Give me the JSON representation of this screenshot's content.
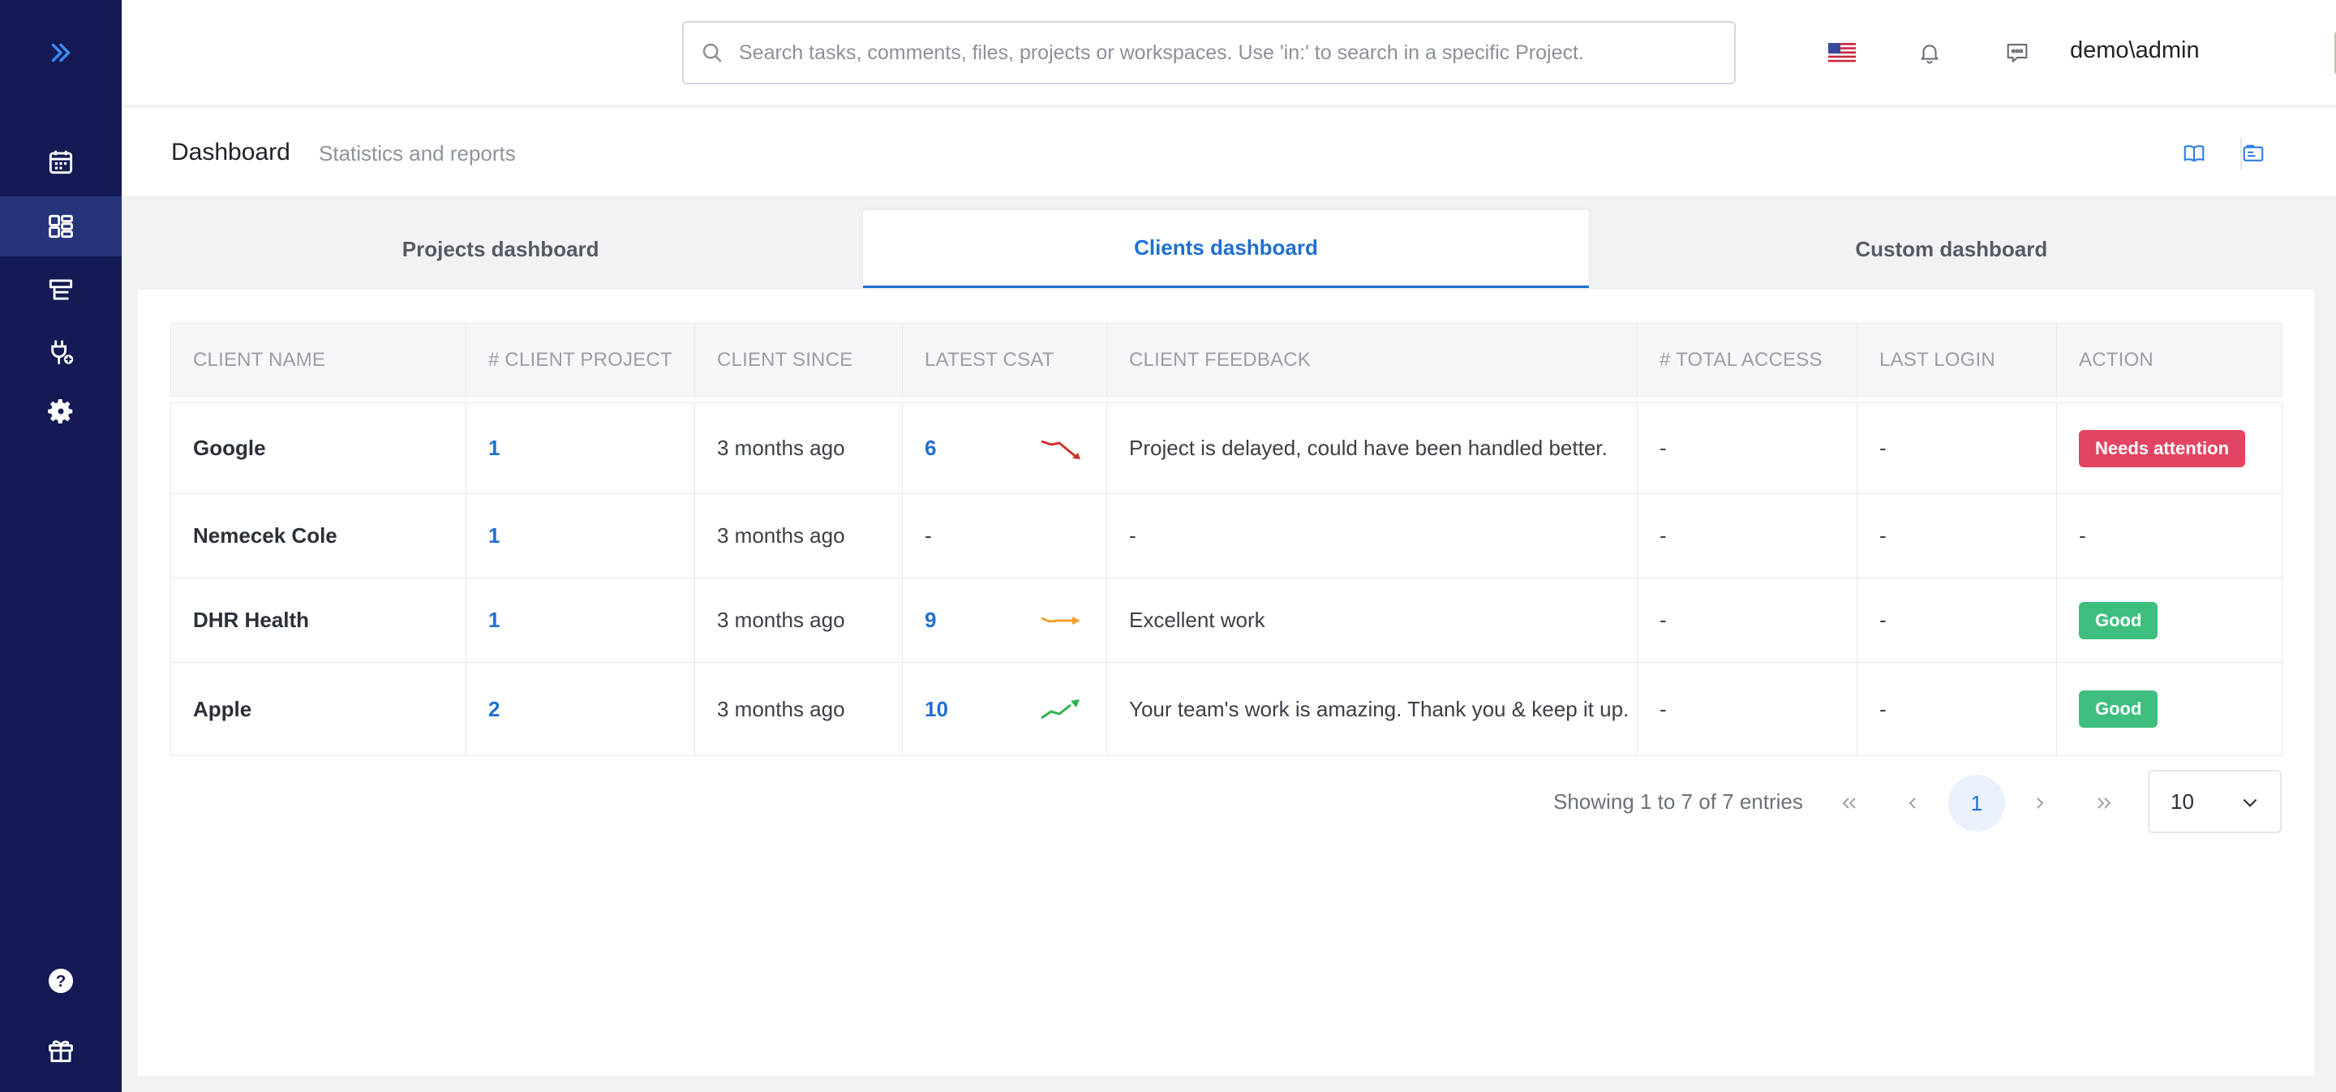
{
  "header": {
    "search_placeholder": "Search tasks, comments, files, projects or workspaces. Use 'in:' to search in a specific Project.",
    "user": "demo\\admin"
  },
  "page": {
    "title": "Dashboard",
    "subtitle": "Statistics and reports"
  },
  "tabs": [
    {
      "label": "Projects dashboard",
      "active": false
    },
    {
      "label": "Clients dashboard",
      "active": true
    },
    {
      "label": "Custom dashboard",
      "active": false
    }
  ],
  "table": {
    "columns": [
      "CLIENT NAME",
      "# CLIENT PROJECT",
      "CLIENT SINCE",
      "LATEST CSAT",
      "CLIENT FEEDBACK",
      "# TOTAL ACCESS",
      "LAST LOGIN",
      "ACTION"
    ],
    "rows": [
      {
        "name": "Google",
        "projects": "1",
        "since": "3 months ago",
        "csat": "6",
        "trend": "down",
        "feedback": "Project is delayed, could have been handled better.",
        "access": "-",
        "login": "-",
        "action": "Needs attention",
        "action_color": "#e24563"
      },
      {
        "name": "Nemecek Cole",
        "projects": "1",
        "since": "3 months ago",
        "csat": "-",
        "trend": "none",
        "feedback": "-",
        "access": "-",
        "login": "-",
        "action": "-",
        "action_color": ""
      },
      {
        "name": "DHR Health",
        "projects": "1",
        "since": "3 months ago",
        "csat": "9",
        "trend": "flat",
        "feedback": "Excellent work",
        "access": "-",
        "login": "-",
        "action": "Good",
        "action_color": "#3fbf7f"
      },
      {
        "name": "Apple",
        "projects": "2",
        "since": "3 months ago",
        "csat": "10",
        "trend": "up",
        "feedback": "Your team's work is amazing. Thank you & keep it up.",
        "access": "-",
        "login": "-",
        "action": "Good",
        "action_color": "#3fbf7f"
      }
    ]
  },
  "pagination": {
    "summary": "Showing 1 to 7 of 7 entries",
    "current_page": "1",
    "page_size": "10"
  },
  "colors": {
    "sidebar_bg": "#131a54",
    "accent": "#1f6fd1",
    "trend_down": "#d0312d",
    "trend_flat": "#f0a030",
    "trend_up": "#2bb24c"
  }
}
